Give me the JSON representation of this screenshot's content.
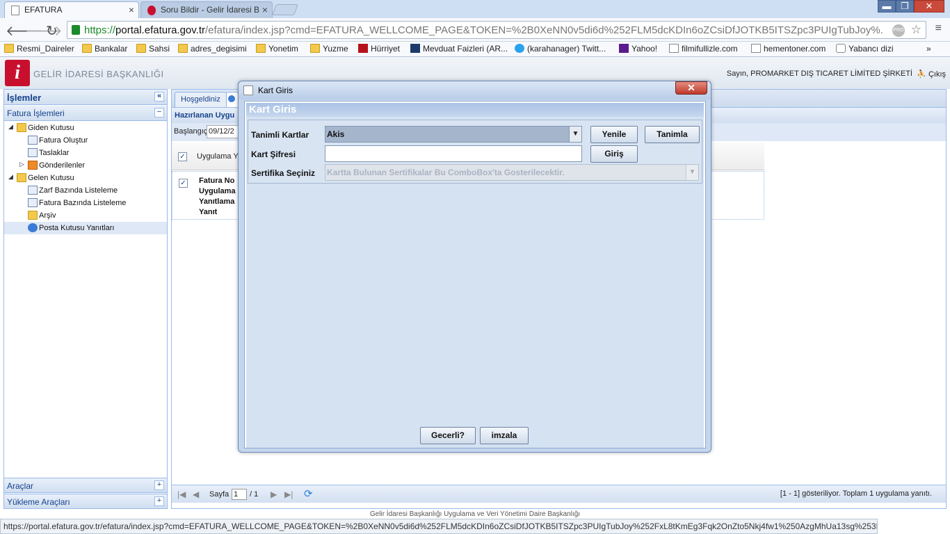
{
  "browser": {
    "tabs": [
      {
        "title": "EFATURA",
        "close": "×"
      },
      {
        "title": "Soru Bildir - Gelir İdaresi B",
        "close": "×"
      }
    ],
    "window": {
      "minimize": "▬",
      "restore": "❐",
      "close": "✕"
    },
    "nav": {
      "back": "🡐",
      "forward": "🡒",
      "reload": "↻"
    },
    "url": {
      "scheme": "https://",
      "host": "portal.efatura.gov.tr",
      "path": "/efatura/index.jsp?cmd=EFATURA_WELLCOME_PAGE&TOKEN=%2B0XeNN0v5di6d%252FLM5dcKDIn6oZCsiDfJOTKB5ITSZpc3PUIgTubJoy%."
    },
    "extension_label": "PRO",
    "star": "☆",
    "menu": "≡",
    "bookmarks": [
      {
        "label": "Resmi_Daireler",
        "icon": "folder-icon"
      },
      {
        "label": "Bankalar",
        "icon": "folder-icon"
      },
      {
        "label": "Sahsi",
        "icon": "folder-icon"
      },
      {
        "label": "adres_degisimi",
        "icon": "folder-icon"
      },
      {
        "label": "Yonetim",
        "icon": "folder-icon"
      },
      {
        "label": "Yuzme",
        "icon": "folder-icon"
      },
      {
        "label": "Hürriyet",
        "icon": "hurriyet-icon"
      },
      {
        "label": "Mevduat Faizleri (AR...",
        "icon": "mevduat-icon"
      },
      {
        "label": "(karahanager) Twitt...",
        "icon": "twitter-icon"
      },
      {
        "label": "Yahoo!",
        "icon": "yahoo-icon"
      },
      {
        "label": "filmifullizle.com",
        "icon": "page-icon"
      },
      {
        "label": "hementoner.com",
        "icon": "page-icon"
      },
      {
        "label": "Yabancı dizi",
        "icon": "yahoo-icon"
      }
    ],
    "bookmarks_more": "»",
    "status_url": "https://portal.efatura.gov.tr/efatura/index.jsp?cmd=EFATURA_WELLCOME_PAGE&TOKEN=%2B0XeNN0v5di6d%252FLM5dcKDIn6oZCsiDfJOTKB5ITSZpc3PUIgTubJoy%252FxL8tKmEg3Fqk2OnZto5Nkj4fw1%250AzgMhUa13sg%253D%253D#"
  },
  "app": {
    "logo_letter": "i",
    "brand": "GELİR İDARESİ BAŞKANLIĞI",
    "user": "Sayın, PROMARKET DIŞ TICARET LİMİTED ŞİRKETİ",
    "logout": "Çıkış"
  },
  "sidebar": {
    "title": "İşlemler",
    "collapse": "«",
    "section": "Fatura İşlemleri",
    "section_toggle": "−",
    "tree": [
      {
        "label": "Giden Kutusu",
        "level": 0,
        "arrow": "◢"
      },
      {
        "label": "Fatura Oluştur",
        "level": 1
      },
      {
        "label": "Taslaklar",
        "level": 1
      },
      {
        "label": "Gönderilenler",
        "level": 1,
        "arrow": "▷"
      },
      {
        "label": "Gelen Kutusu",
        "level": 0,
        "arrow": "◢"
      },
      {
        "label": "Zarf Bazında Listeleme",
        "level": 1
      },
      {
        "label": "Fatura Bazında Listeleme",
        "level": 1
      },
      {
        "label": "Arşiv",
        "level": 1
      },
      {
        "label": "Posta Kutusu Yanıtları",
        "level": 1
      }
    ],
    "bottom_panels": [
      {
        "label": "Araçlar",
        "toggle": "+"
      },
      {
        "label": "Yükleme Araçları",
        "toggle": "+"
      }
    ]
  },
  "main": {
    "tabs": [
      {
        "label": "Hoşgeldiniz"
      }
    ],
    "title": "Hazırlanan Uygu",
    "filter_label": "Başlangıç",
    "filter_value": "09/12/2",
    "grid_header": "Uygulama Y",
    "check": "✓",
    "row_cell": [
      "Fatura No",
      "Uygulama",
      "Yanıtlama",
      "Yanıt"
    ],
    "pager": {
      "first": "|◀",
      "prev": "◀",
      "page_label": "Sayfa",
      "page_value": "1",
      "of": "/ 1",
      "next": "▶",
      "last": "▶|",
      "refresh": "⟳",
      "status": "[1 - 1] gösteriliyor. Toplam 1 uygulama yanıtı."
    },
    "footer": "Gelir İdaresi Başkanlığı Uygulama ve Veri Yönetimi Daire Başkanlığı"
  },
  "dialog": {
    "window_title": "Kart Giris",
    "close": "✕",
    "heading": "Kart Giris",
    "fields": {
      "cards_label": "Tanimli Kartlar",
      "cards_value": "Akis",
      "pin_label": "Kart Şifresi",
      "pin_value": "",
      "cert_label": "Sertifika Seçiniz",
      "cert_placeholder": "Kartta Bulunan Sertifikalar Bu ComboBox'ta Gosterilecektir."
    },
    "arrow": "▼",
    "buttons": {
      "refresh": "Yenile",
      "define": "Tanimla",
      "login": "Giriş",
      "valid": "Gecerli?",
      "sign": "imzala"
    }
  },
  "colors": {
    "brand_red": "#c8102e",
    "panel_blue": "#15428b",
    "border_blue": "#99bbe8",
    "secure_green": "#1a8a2a"
  }
}
